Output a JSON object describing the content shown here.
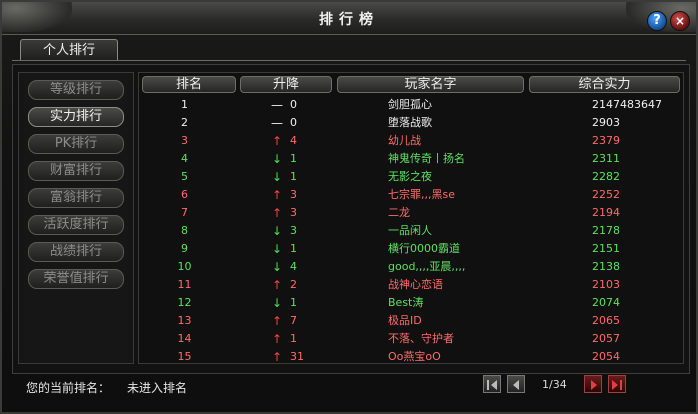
{
  "window": {
    "title": "排行榜"
  },
  "buttons": {
    "help": "?",
    "close": "×"
  },
  "tab": {
    "label": "个人排行"
  },
  "sidebar": {
    "items": [
      {
        "label": "等级排行",
        "active": false
      },
      {
        "label": "实力排行",
        "active": true
      },
      {
        "label": "PK排行",
        "active": false
      },
      {
        "label": "财富排行",
        "active": false
      },
      {
        "label": "富翁排行",
        "active": false
      },
      {
        "label": "活跃度排行",
        "active": false
      },
      {
        "label": "战绩排行",
        "active": false
      },
      {
        "label": "荣誉值排行",
        "active": false
      }
    ]
  },
  "table": {
    "headers": [
      "排名",
      "升降",
      "玩家名字",
      "综合实力"
    ],
    "colors": {
      "white": "#f0f0f0",
      "red": "#ff6b6b",
      "green": "#5fe05f",
      "up": "#ff4040",
      "down": "#4fe04f",
      "flat": "#f0f0f0"
    },
    "rows": [
      {
        "rank": "1",
        "arrow": "—",
        "trend": "flat",
        "delta": "0",
        "name": "剑胆孤心",
        "power": "2147483647",
        "color": "white"
      },
      {
        "rank": "2",
        "arrow": "—",
        "trend": "flat",
        "delta": "0",
        "name": "堕落战歌",
        "power": "2903",
        "color": "white"
      },
      {
        "rank": "3",
        "arrow": "↑",
        "trend": "up",
        "delta": "4",
        "name": "幼儿战",
        "power": "2379",
        "color": "red"
      },
      {
        "rank": "4",
        "arrow": "↓",
        "trend": "down",
        "delta": "1",
        "name": "神鬼传奇丨扬名",
        "power": "2311",
        "color": "green"
      },
      {
        "rank": "5",
        "arrow": "↓",
        "trend": "down",
        "delta": "1",
        "name": "无影之夜",
        "power": "2282",
        "color": "green"
      },
      {
        "rank": "6",
        "arrow": "↑",
        "trend": "up",
        "delta": "3",
        "name": "七宗罪,,,黑se",
        "power": "2252",
        "color": "red"
      },
      {
        "rank": "7",
        "arrow": "↑",
        "trend": "up",
        "delta": "3",
        "name": "二龙",
        "power": "2194",
        "color": "red"
      },
      {
        "rank": "8",
        "arrow": "↓",
        "trend": "down",
        "delta": "3",
        "name": "一品闲人",
        "power": "2178",
        "color": "green"
      },
      {
        "rank": "9",
        "arrow": "↓",
        "trend": "down",
        "delta": "1",
        "name": "横行0000霸道",
        "power": "2151",
        "color": "green"
      },
      {
        "rank": "10",
        "arrow": "↓",
        "trend": "down",
        "delta": "4",
        "name": "good,,,,亚晨,,,,",
        "power": "2138",
        "color": "green"
      },
      {
        "rank": "11",
        "arrow": "↑",
        "trend": "up",
        "delta": "2",
        "name": "战神心恋语",
        "power": "2103",
        "color": "red"
      },
      {
        "rank": "12",
        "arrow": "↓",
        "trend": "down",
        "delta": "1",
        "name": "Best涛",
        "power": "2074",
        "color": "green"
      },
      {
        "rank": "13",
        "arrow": "↑",
        "trend": "up",
        "delta": "7",
        "name": "极品ID",
        "power": "2065",
        "color": "red"
      },
      {
        "rank": "14",
        "arrow": "↑",
        "trend": "up",
        "delta": "1",
        "name": "不落、守护者",
        "power": "2057",
        "color": "red"
      },
      {
        "rank": "15",
        "arrow": "↑",
        "trend": "up",
        "delta": "31",
        "name": "Oo燕宝oO",
        "power": "2054",
        "color": "red"
      }
    ]
  },
  "footer": {
    "label": "您的当前排名：",
    "value": "未进入排名",
    "page_indicator": "1/34"
  }
}
